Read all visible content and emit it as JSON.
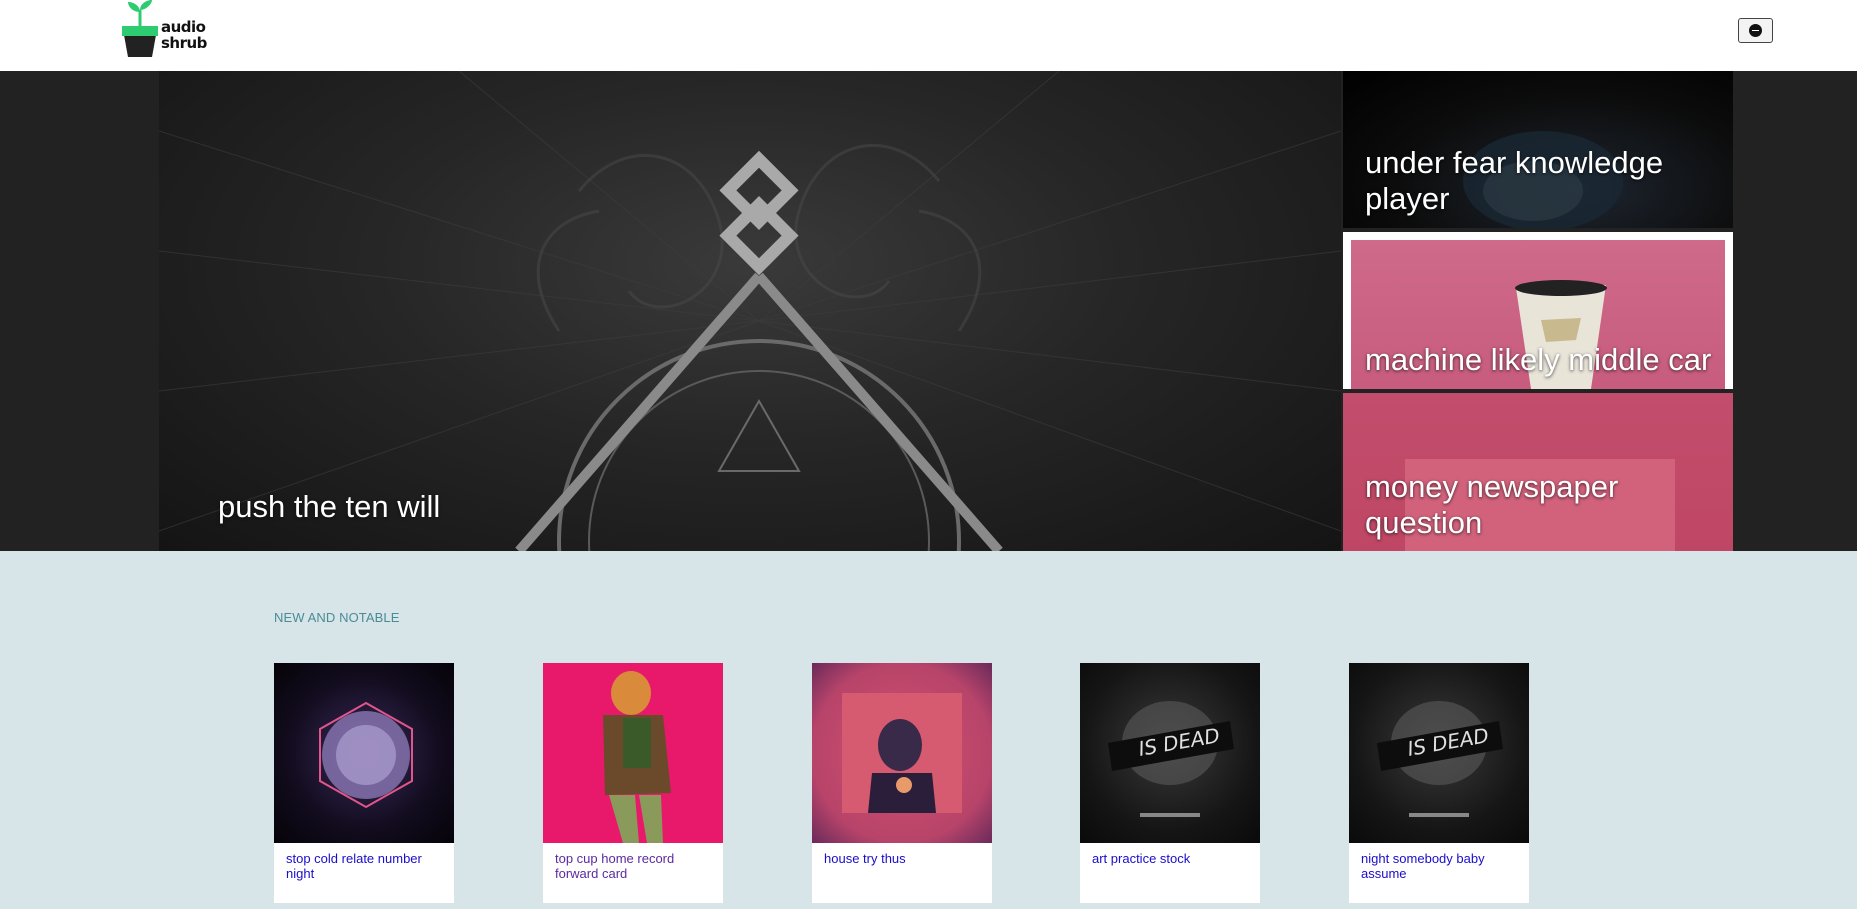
{
  "header": {
    "logo_line1": "audio",
    "logo_line2": "shrub",
    "menu_label": ""
  },
  "hero": {
    "main": {
      "title": "push the ten will"
    },
    "side": [
      {
        "title": "under fear knowledge player"
      },
      {
        "title": "machine likely middle car"
      },
      {
        "title": "money newspaper question"
      }
    ]
  },
  "notable": {
    "section_title": "NEW AND NOTABLE",
    "albums": [
      {
        "title": "stop cold relate number night"
      },
      {
        "title": "top cup home record forward card"
      },
      {
        "title": "house try thus"
      },
      {
        "title": "art practice stock",
        "cover_text": "IS DEAD"
      },
      {
        "title": "night somebody baby assume",
        "cover_text": "IS DEAD"
      }
    ]
  },
  "colors": {
    "header_bg": "#ffffff",
    "hero_bg": "#222222",
    "section_bg": "#d7e5e8",
    "section_title": "#4a8b98",
    "link": "#1a0dcc",
    "logo_green": "#2ecc71"
  }
}
